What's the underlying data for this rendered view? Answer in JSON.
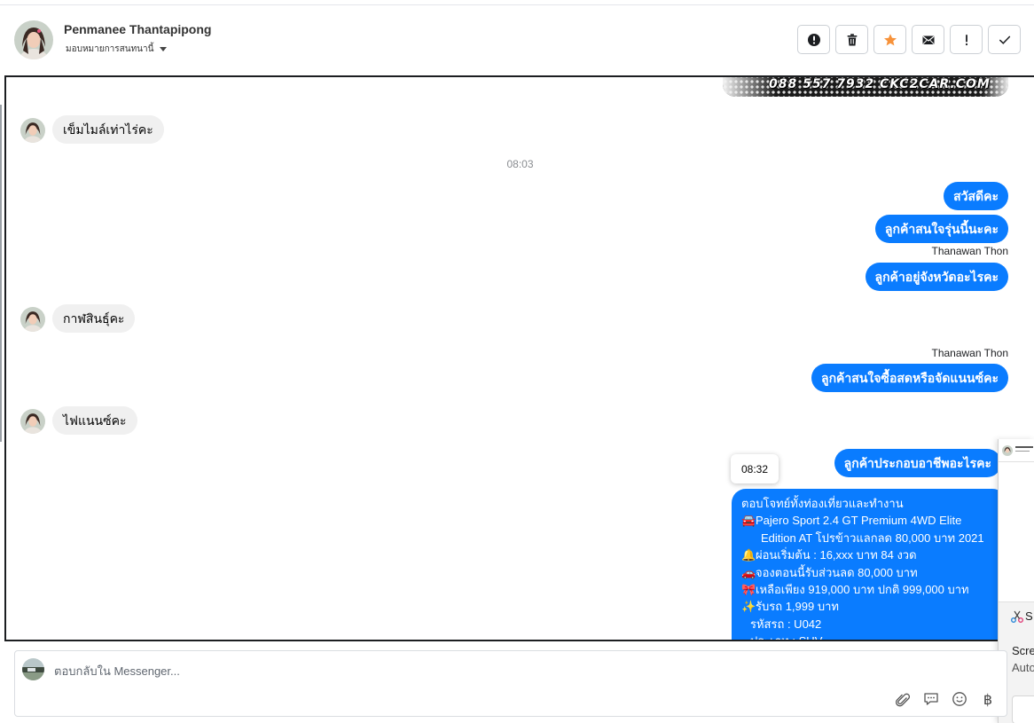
{
  "header": {
    "contact_name": "Penmanee Thantapipong",
    "assign_label": "มอบหมายการสนทนานี้",
    "actions": [
      {
        "name": "spam-button",
        "icon": "alert-circle-icon"
      },
      {
        "name": "delete-button",
        "icon": "trash-icon"
      },
      {
        "name": "star-button",
        "icon": "star-icon"
      },
      {
        "name": "mark-unread-button",
        "icon": "envelope-icon"
      },
      {
        "name": "follow-up-button",
        "icon": "exclamation-icon"
      },
      {
        "name": "done-button",
        "icon": "check-icon"
      }
    ]
  },
  "colors": {
    "outgoing_bubble": "#0a7cff",
    "incoming_bubble": "#f0f0f0",
    "star": "#f7923a"
  },
  "image_preview": {
    "text": "088 557 7932 CKC2CAR.COM"
  },
  "messages": {
    "in_1": "เข็มไมล์เท่าไร่คะ",
    "time_1": "08:03",
    "out_1": "สวัสดีคะ",
    "out_2": "ลูกค้าสนใจรุ่นนี้นะคะ",
    "sender_1": "Thanawan Thon",
    "out_3": "ลูกค้าอยู่จังหวัดอะไรคะ",
    "in_2": "กาฬสินธุ์คะ",
    "sender_2": "Thanawan Thon",
    "out_4": "ลูกค้าสนใจซื้อสดหรือจัดแนนซ์คะ",
    "in_3": "ไฟแนนซ์คะ",
    "out_5": "ลูกค้าประกอบอาชีพอะไรคะ",
    "tooltip_time": "08:32"
  },
  "long_message": {
    "line_1": "ตอบโจทย์ทั้งท่องเที่ยวและทำงาน",
    "line_2": "Pajero Sport 2.4 GT Premium 4WD Elite",
    "line_3": "Edition AT โปรข้าวแลกลด 80,000 บาท 2021",
    "line_4": "ผ่อนเริ่มต้น : 16,xxx บาท 84 งวด",
    "line_5": "จองตอนนี้รับส่วนลด 80,000 บาท",
    "line_6": "เหลือเพียง 919,000 บาท ปกติ 999,000 บาท",
    "line_7": "รับรถ 1,999 บาท",
    "line_8": "รหัสรถ : U042",
    "line_9": "ประเภท : SUV"
  },
  "snip_notification": {
    "title": "S",
    "line_1": "Scre",
    "line_2": "Auto"
  },
  "composer": {
    "placeholder": "ตอบกลับใน Messenger...",
    "tools": [
      "paperclip-icon",
      "speech-bubble-icon",
      "emoji-icon",
      "baht-icon"
    ],
    "baht_symbol": "฿"
  }
}
